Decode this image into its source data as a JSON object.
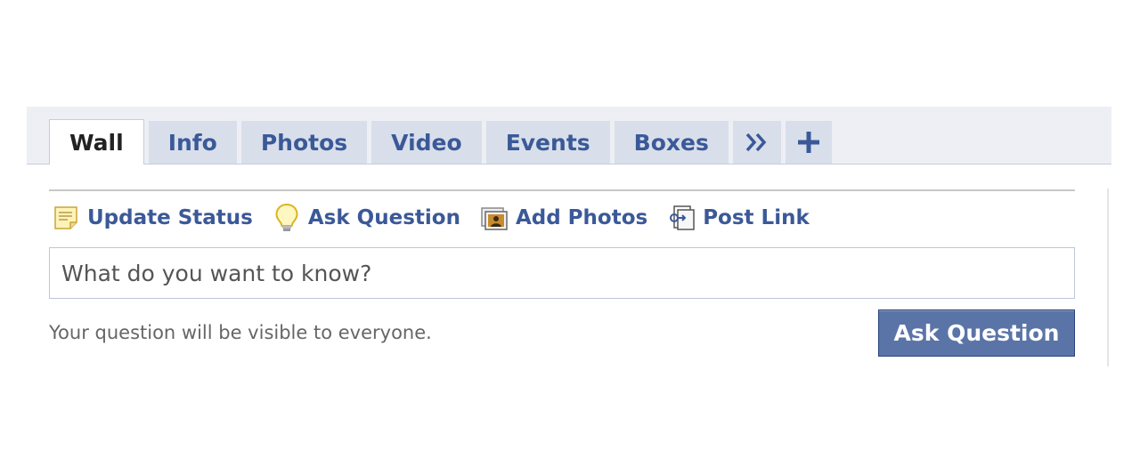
{
  "tabs": [
    {
      "label": "Wall",
      "active": true
    },
    {
      "label": "Info"
    },
    {
      "label": "Photos"
    },
    {
      "label": "Video"
    },
    {
      "label": "Events"
    },
    {
      "label": "Boxes"
    }
  ],
  "tab_more_icon": "double-chevron-right-icon",
  "tab_add_icon": "plus-icon",
  "composer": {
    "actions": [
      {
        "label": "Update Status",
        "icon": "status-note-icon"
      },
      {
        "label": "Ask Question",
        "icon": "lightbulb-icon"
      },
      {
        "label": "Add Photos",
        "icon": "photo-icon"
      },
      {
        "label": "Post Link",
        "icon": "link-icon"
      }
    ],
    "input_text": "What do you want to know?",
    "hint": "Your question will be visible to everyone.",
    "submit_label": "Ask Question"
  },
  "colors": {
    "brand_blue": "#3b5998",
    "tab_bg": "#d8dfea",
    "strip_bg": "#edeff4",
    "button_bg": "#5b74a8"
  }
}
